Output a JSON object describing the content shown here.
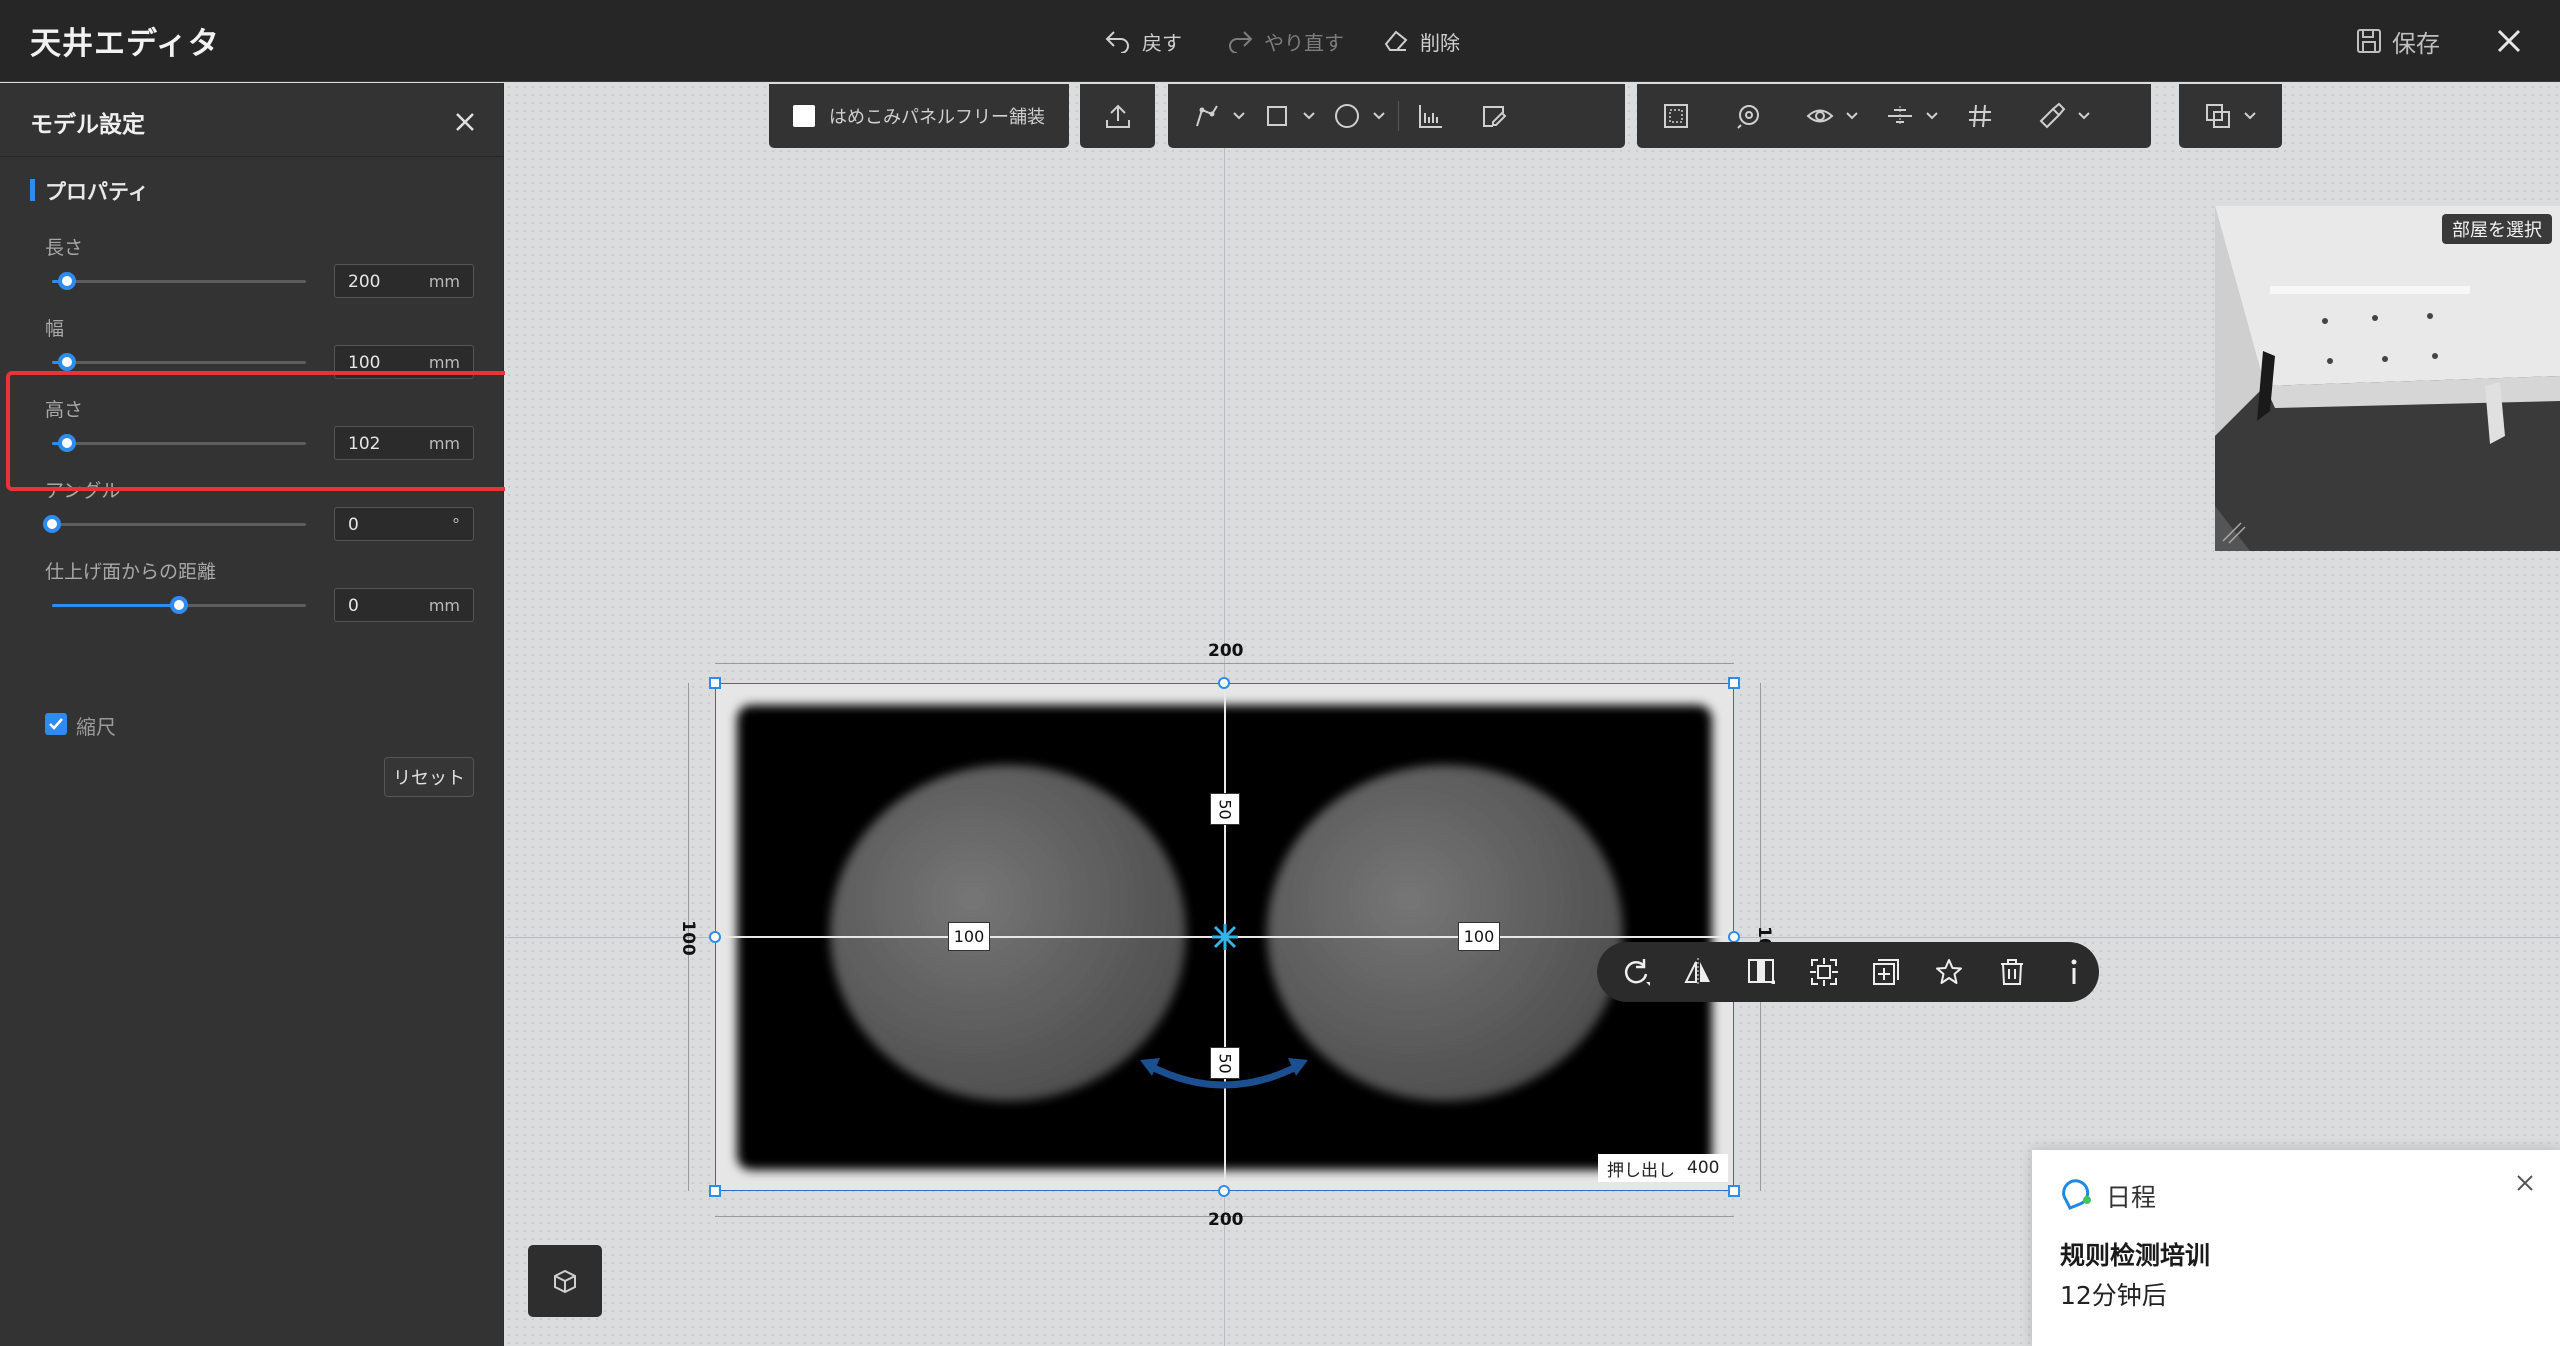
{
  "app": {
    "title": "天井エディタ"
  },
  "topbar": {
    "undo_label": "戻す",
    "redo_label": "やり直す",
    "delete_label": "削除",
    "save_label": "保存"
  },
  "panel": {
    "title": "モデル設定",
    "section_title": "プロパティ",
    "properties": [
      {
        "label": "長さ",
        "value": "200",
        "unit": "mm",
        "slider_fraction": 0.06
      },
      {
        "label": "幅",
        "value": "100",
        "unit": "mm",
        "slider_fraction": 0.06
      },
      {
        "label": "高さ",
        "value": "102",
        "unit": "mm",
        "slider_fraction": 0.06
      },
      {
        "label": "アングル",
        "value": "0",
        "unit": "°",
        "slider_fraction": 0.0
      },
      {
        "label": "仕上げ面からの距離",
        "value": "0",
        "unit": "mm",
        "slider_fraction": 0.5
      }
    ],
    "scale_label": "縮尺",
    "scale_checked": true,
    "reset_label": "リセット"
  },
  "toolbar": {
    "panel_free_label": "はめこみパネルフリー舗装"
  },
  "minimap": {
    "room_select_label": "部屋を選択"
  },
  "model": {
    "width_top": "200",
    "width_bottom": "200",
    "height_left": "100",
    "height_right": "10",
    "offset_top": "50",
    "offset_bottom": "50",
    "offset_left": "100",
    "offset_right": "100",
    "extrude_label": "押し出し",
    "extrude_value": "400"
  },
  "notification": {
    "app": "日程",
    "title": "规则检测培训",
    "time": "12分钟后"
  },
  "colors": {
    "accent": "#2e8cf0",
    "highlight": "#e8333a",
    "panel_bg": "#333333"
  }
}
